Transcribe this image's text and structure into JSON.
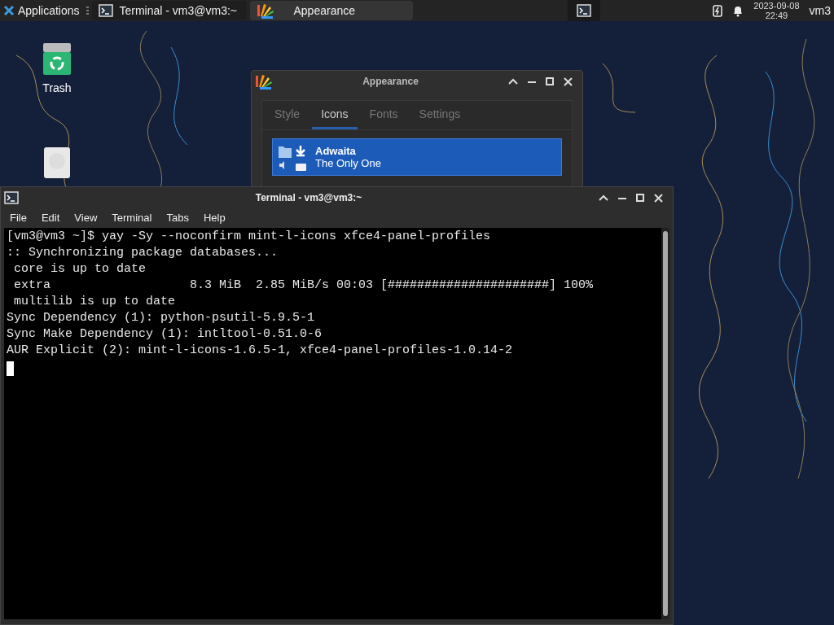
{
  "panel": {
    "apps_menu": "Applications",
    "tasks": [
      {
        "title": "Terminal - vm3@vm3:~",
        "kind": "terminal",
        "selected": false
      },
      {
        "title": "Appearance",
        "kind": "appearance",
        "selected": true
      }
    ],
    "clock": {
      "date": "2023-09-08",
      "time": "22:49"
    },
    "user": "vm3"
  },
  "desktop_icons": [
    {
      "label": "Trash",
      "kind": "trash"
    },
    {
      "kind": "disk"
    }
  ],
  "appearance": {
    "title": "Appearance",
    "tabs": [
      {
        "label": "Style",
        "selected": false
      },
      {
        "label": "Icons",
        "selected": true
      },
      {
        "label": "Fonts",
        "selected": false
      },
      {
        "label": "Settings",
        "selected": false
      }
    ],
    "themes": [
      {
        "name": "Adwaita",
        "description": "The Only One",
        "selected": true
      }
    ]
  },
  "terminal": {
    "title": "Terminal - vm3@vm3:~",
    "menu": [
      "File",
      "Edit",
      "View",
      "Terminal",
      "Tabs",
      "Help"
    ],
    "lines": [
      "[vm3@vm3 ~]$ yay -Sy --noconfirm mint-l-icons xfce4-panel-profiles",
      ":: Synchronizing package databases...",
      " core is up to date",
      " extra                   8.3 MiB  2.85 MiB/s 00:03 [######################] 100%",
      " multilib is up to date",
      "Sync Dependency (1): python-psutil-5.9.5-1",
      "Sync Make Dependency (1): intltool-0.51.0-6",
      "AUR Explicit (2): mint-l-icons-1.6.5-1, xfce4-panel-profiles-1.0.14-2"
    ]
  }
}
